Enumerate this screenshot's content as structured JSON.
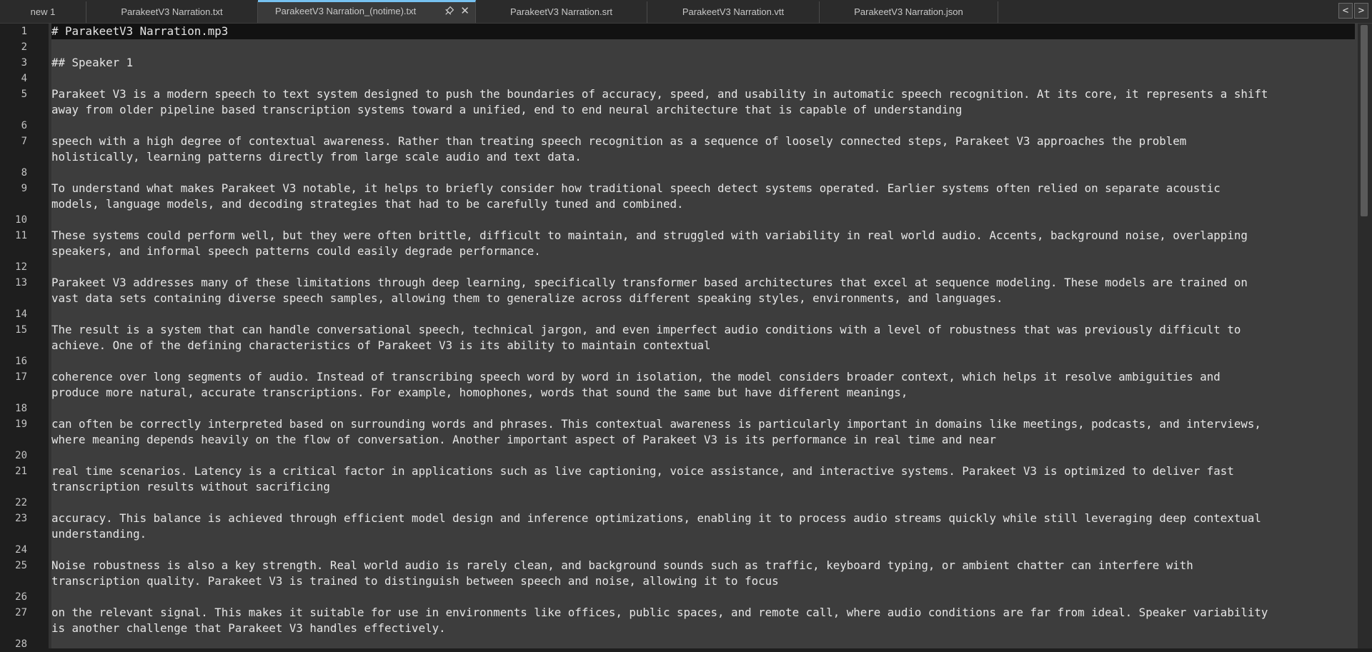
{
  "tabs": [
    {
      "label": "new 1"
    },
    {
      "label": "ParakeetV3 Narration.txt"
    },
    {
      "label": "ParakeetV3 Narration_(notime).txt",
      "active": true
    },
    {
      "label": "ParakeetV3 Narration.srt"
    },
    {
      "label": "ParakeetV3 Narration.vtt"
    },
    {
      "label": "ParakeetV3 Narration.json"
    }
  ],
  "tab_nav": {
    "prev": "<",
    "next": ">"
  },
  "colors": {
    "active_tab_accent": "#76c1f0",
    "editor_bg": "#3d3d3d",
    "current_line_bg": "#121212"
  },
  "lines": [
    {
      "num": "1",
      "text": "# ParakeetV3 Narration.mp3"
    },
    {
      "num": "2",
      "text": ""
    },
    {
      "num": "3",
      "text": "## Speaker 1"
    },
    {
      "num": "4",
      "text": ""
    },
    {
      "num": "5",
      "text": "Parakeet V3 is a modern speech to text system designed to push the boundaries of accuracy, speed, and usability in automatic speech recognition. At its core, it represents a shift",
      "wrap": "away from older pipeline based transcription systems toward a unified, end to end neural architecture that is capable of understanding"
    },
    {
      "num": "6",
      "text": ""
    },
    {
      "num": "7",
      "text": "speech with a high degree of contextual awareness. Rather than treating speech recognition as a sequence of loosely connected steps, Parakeet V3 approaches the problem",
      "wrap": "holistically, learning patterns directly from large scale audio and text data."
    },
    {
      "num": "8",
      "text": ""
    },
    {
      "num": "9",
      "text": "To understand what makes Parakeet V3 notable, it helps to briefly consider how traditional speech detect systems operated. Earlier systems often relied on separate acoustic",
      "wrap": "models, language models, and decoding strategies that had to be carefully tuned and combined."
    },
    {
      "num": "10",
      "text": ""
    },
    {
      "num": "11",
      "text": "These systems could perform well, but they were often brittle, difficult to maintain, and struggled with variability in real world audio. Accents, background noise, overlapping",
      "wrap": "speakers, and informal speech patterns could easily degrade performance."
    },
    {
      "num": "12",
      "text": ""
    },
    {
      "num": "13",
      "text": "Parakeet V3 addresses many of these limitations through deep learning, specifically transformer based architectures that excel at sequence modeling. These models are trained on",
      "wrap": "vast data sets containing diverse speech samples, allowing them to generalize across different speaking styles, environments, and languages."
    },
    {
      "num": "14",
      "text": ""
    },
    {
      "num": "15",
      "text": "The result is a system that can handle conversational speech, technical jargon, and even imperfect audio conditions with a level of robustness that was previously difficult to",
      "wrap": "achieve. One of the defining characteristics of Parakeet V3 is its ability to maintain contextual"
    },
    {
      "num": "16",
      "text": ""
    },
    {
      "num": "17",
      "text": "coherence over long segments of audio. Instead of transcribing speech word by word in isolation, the model considers broader context, which helps it resolve ambiguities and",
      "wrap": "produce more natural, accurate transcriptions. For example, homophones, words that sound the same but have different meanings,"
    },
    {
      "num": "18",
      "text": ""
    },
    {
      "num": "19",
      "text": "can often be correctly interpreted based on surrounding words and phrases. This contextual awareness is particularly important in domains like meetings, podcasts, and interviews,",
      "wrap": "where meaning depends heavily on the flow of conversation. Another important aspect of Parakeet V3 is its performance in real time and near"
    },
    {
      "num": "20",
      "text": ""
    },
    {
      "num": "21",
      "text": "real time scenarios. Latency is a critical factor in applications such as live captioning, voice assistance, and interactive systems. Parakeet V3 is optimized to deliver fast",
      "wrap": "transcription results without sacrificing"
    },
    {
      "num": "22",
      "text": ""
    },
    {
      "num": "23",
      "text": "accuracy. This balance is achieved through efficient model design and inference optimizations, enabling it to process audio streams quickly while still leveraging deep contextual",
      "wrap": "understanding."
    },
    {
      "num": "24",
      "text": ""
    },
    {
      "num": "25",
      "text": "Noise robustness is also a key strength. Real world audio is rarely clean, and background sounds such as traffic, keyboard typing, or ambient chatter can interfere with",
      "wrap": "transcription quality. Parakeet V3 is trained to distinguish between speech and noise, allowing it to focus"
    },
    {
      "num": "26",
      "text": ""
    },
    {
      "num": "27",
      "text": "on the relevant signal. This makes it suitable for use in environments like offices, public spaces, and remote call, where audio conditions are far from ideal. Speaker variability",
      "wrap": "is another challenge that Parakeet V3 handles effectively."
    },
    {
      "num": "28",
      "text": ""
    }
  ]
}
